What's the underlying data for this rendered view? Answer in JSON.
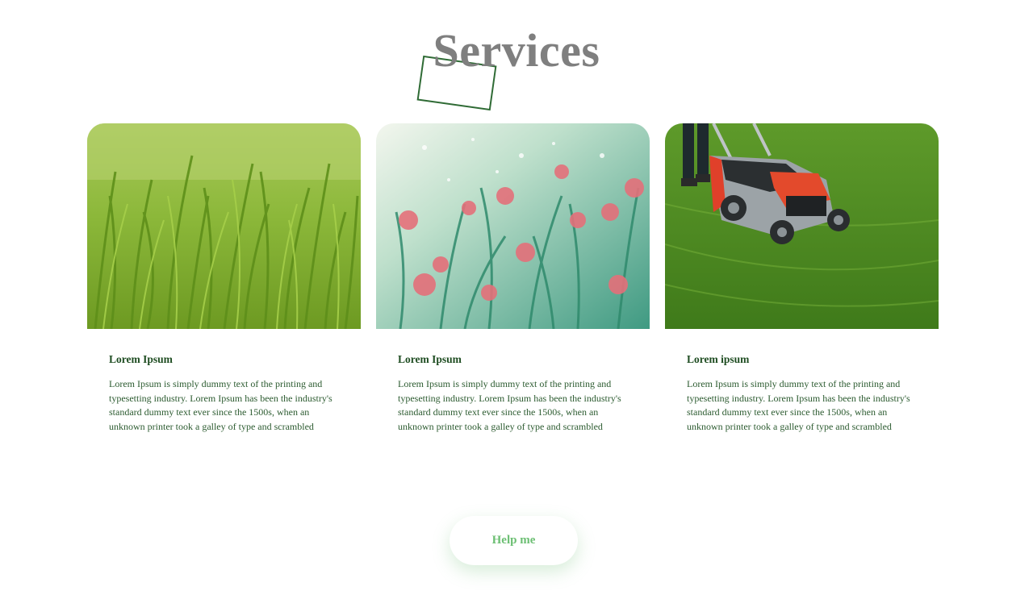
{
  "section": {
    "title": "Services"
  },
  "cards": [
    {
      "image": "tall-green-grass",
      "title": "Lorem Ipsum",
      "text": "Lorem Ipsum is simply dummy text of the printing and typesetting industry. Lorem Ipsum has been the industry's standard dummy text ever since the 1500s, when an unknown printer took a galley of type and scrambled"
    },
    {
      "image": "pink-wildflowers",
      "title": "Lorem Ipsum",
      "text": "Lorem Ipsum is simply dummy text of the printing and typesetting industry. Lorem Ipsum has been the industry's standard dummy text ever since the 1500s, when an unknown printer took a galley of type and scrambled"
    },
    {
      "image": "lawn-mower",
      "title": "Lorem ipsum",
      "text": "Lorem Ipsum is simply dummy text of the printing and typesetting industry. Lorem Ipsum has been the industry's standard dummy text ever since the 1500s, when an unknown printer took a galley of type and scrambled"
    }
  ],
  "cta": {
    "label": "Help me"
  },
  "colors": {
    "heading": "#7f7f7f",
    "accent_dark": "#1f4d22",
    "accent_light": "#6cbf73"
  }
}
